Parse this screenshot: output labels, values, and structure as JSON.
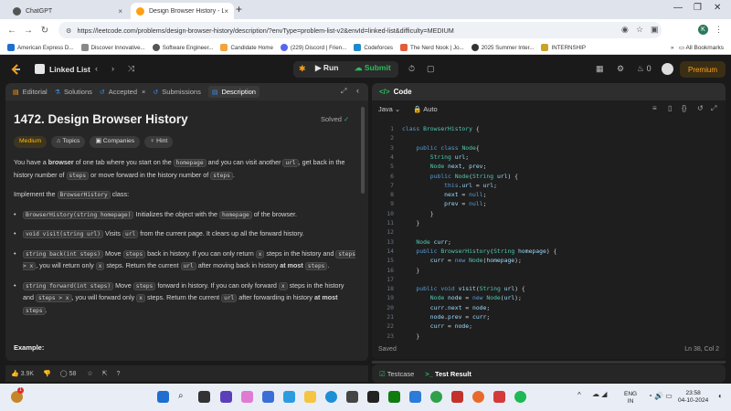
{
  "browser": {
    "tabs": [
      {
        "title": "ChatGPT"
      },
      {
        "title": "Design Browser History - LeetC"
      }
    ],
    "url": "https://leetcode.com/problems/design-browser-history/description/?envType=problem-list-v2&envId=linked-list&difficulty=MEDIUM",
    "bookmarks": [
      "American Express D...",
      "Discover Innovative...",
      "Software Engineer...",
      "Candidate Home",
      "(229) Discord | Frien...",
      "Codeforces",
      "The Nerd Nook | Jo...",
      "2025 Summer Inter...",
      "INTERNSHIP"
    ],
    "all_bookmarks": "All Bookmarks"
  },
  "header": {
    "problem_list": "Linked List",
    "run": "Run",
    "submit": "Submit",
    "streak": "0",
    "premium": "Premium"
  },
  "left": {
    "tabs": [
      "Editorial",
      "Solutions",
      "Accepted",
      "Submissions",
      "Description"
    ],
    "title": "1472. Design Browser History",
    "solved": "Solved",
    "chips": [
      "Medium",
      "Topics",
      "Companies",
      "Hint"
    ],
    "intro": {
      "p1a": "You have a ",
      "p1b": "browser",
      "p1c": " of one tab where you start on the ",
      "c1": "homepage",
      "p1d": " and you can visit another ",
      "c2": "url",
      "p1e": ", get back in the history number of ",
      "c3": "steps",
      "p1f": " or move forward in the history number of ",
      "c4": "steps",
      "p1g": "."
    },
    "impl_a": "Implement the ",
    "impl_code": "BrowserHistory",
    "impl_b": " class:",
    "bullets": {
      "b1_code": "BrowserHistory(string homepage)",
      "b1a": " Initializes the object with the ",
      "b1_code2": "homepage",
      "b1b": " of the browser.",
      "b2_code": "void visit(string url)",
      "b2a": " Visits ",
      "b2_code2": "url",
      "b2b": " from the current page. It clears up all the forward history.",
      "b3_code": "string back(int steps)",
      "b3a": " Move ",
      "b3_c2": "steps",
      "b3b": " back in history. If you can only return ",
      "b3_c3": "x",
      "b3c": " steps in the history and ",
      "b3_c4": "steps > x",
      "b3d": ", you will return only ",
      "b3_c5": "x",
      "b3e": " steps. Return the current ",
      "b3_c6": "url",
      "b3f": " after moving back in history ",
      "b3_bold": "at most",
      "b3_c7": "steps",
      "b3g": ".",
      "b4_code": "string forward(int steps)",
      "b4a": " Move ",
      "b4_c2": "steps",
      "b4b": " forward in history. If you can only forward ",
      "b4_c3": "x",
      "b4c": " steps in the history and ",
      "b4_c4": "steps > x",
      "b4d": ", you will forward only ",
      "b4_c5": "x",
      "b4e": " steps. Return the current ",
      "b4_c6": "url",
      "b4f": " after forwarding in history ",
      "b4_bold": "at most",
      "b4_c7": "steps",
      "b4g": "."
    },
    "example": "Example:",
    "likes": "3.9K",
    "comments": "58"
  },
  "right": {
    "title": "Code",
    "language": "Java",
    "mode": "Auto",
    "saved": "Saved",
    "cursor": "Ln 38, Col 2",
    "testcase": "Testcase",
    "test_result": "Test Result"
  },
  "taskbar": {
    "lang": "ENG",
    "region": "IN",
    "time": "23:58",
    "date": "04-10-2024",
    "notification": "1"
  },
  "code_lines": [
    "class BrowserHistory {",
    "",
    "    public class Node{",
    "        String url;",
    "        Node next, prev;",
    "        public Node(String url) {",
    "            this.url = url;",
    "            next = null;",
    "            prev = null;",
    "        }",
    "    }",
    "",
    "    Node curr;",
    "    public BrowserHistory(String homepage) {",
    "        curr = new Node(homepage);",
    "    }",
    "",
    "    public void visit(String url) {",
    "        Node node = new Node(url);",
    "        curr.next = node;",
    "        node.prev = curr;",
    "        curr = node;",
    "    }"
  ]
}
